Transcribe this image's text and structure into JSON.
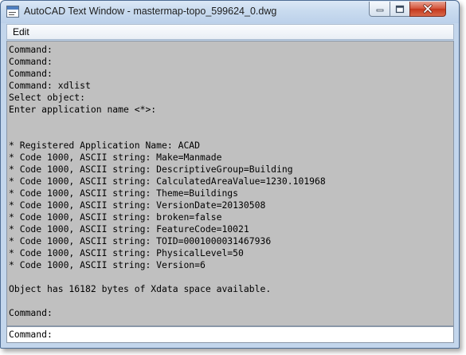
{
  "window": {
    "title": "AutoCAD Text Window - mastermap-topo_599624_0.dwg"
  },
  "menubar": {
    "items": [
      "Edit"
    ]
  },
  "console": {
    "lines": [
      "Command:",
      "Command:",
      "Command:",
      "Command: xdlist",
      "Select object:",
      "Enter application name <*>:",
      "",
      "",
      "* Registered Application Name: ACAD",
      "* Code 1000, ASCII string: Make=Manmade",
      "* Code 1000, ASCII string: DescriptiveGroup=Building",
      "* Code 1000, ASCII string: CalculatedAreaValue=1230.101968",
      "* Code 1000, ASCII string: Theme=Buildings",
      "* Code 1000, ASCII string: VersionDate=20130508",
      "* Code 1000, ASCII string: broken=false",
      "* Code 1000, ASCII string: FeatureCode=10021",
      "* Code 1000, ASCII string: TOID=0001000031467936",
      "* Code 1000, ASCII string: PhysicalLevel=50",
      "* Code 1000, ASCII string: Version=6",
      "",
      "Object has 16182 bytes of Xdata space available.",
      "",
      "Command:"
    ]
  },
  "command_line": {
    "prompt": "Command:",
    "value": ""
  },
  "icons": {
    "app": "autocad-text-window-icon",
    "minimize": "minimize-icon",
    "maximize": "maximize-icon",
    "close": "close-icon"
  }
}
